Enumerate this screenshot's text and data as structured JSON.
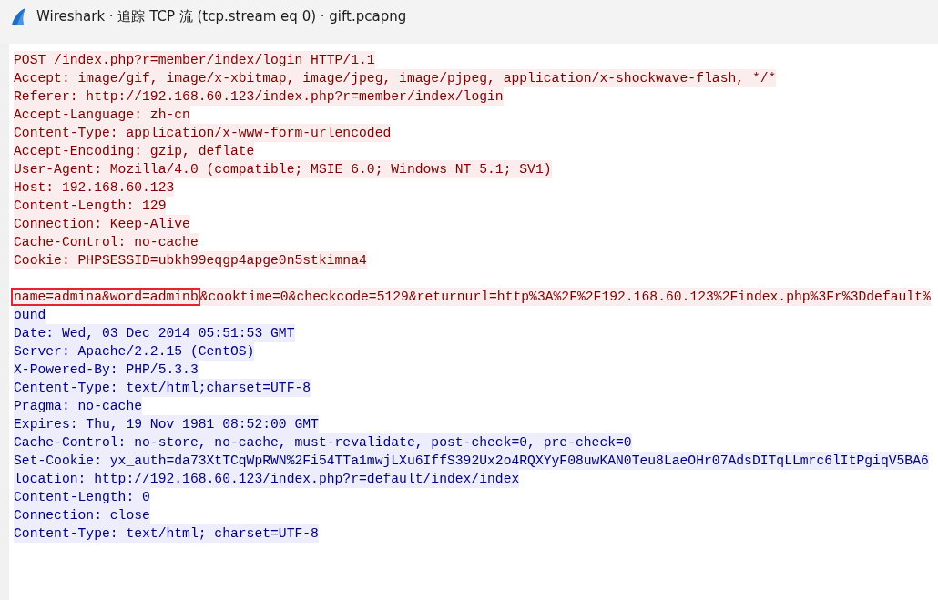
{
  "window": {
    "title": "Wireshark · 追踪 TCP 流 (tcp.stream eq 0) · gift.pcapng"
  },
  "lines": [
    {
      "kind": "client",
      "segments": [
        {
          "text": "POST /index.php?r=member/index/login HTTP/1.1",
          "boxed": false
        }
      ]
    },
    {
      "kind": "client",
      "segments": [
        {
          "text": "Accept: image/gif, image/x-xbitmap, image/jpeg, image/pjpeg, application/x-shockwave-flash, */*",
          "boxed": false
        }
      ]
    },
    {
      "kind": "client",
      "segments": [
        {
          "text": "Referer: http://192.168.60.123/index.php?r=member/index/login",
          "boxed": false
        }
      ]
    },
    {
      "kind": "client",
      "segments": [
        {
          "text": "Accept-Language: zh-cn",
          "boxed": false
        }
      ]
    },
    {
      "kind": "client",
      "segments": [
        {
          "text": "Content-Type: application/x-www-form-urlencoded",
          "boxed": false
        }
      ]
    },
    {
      "kind": "client",
      "segments": [
        {
          "text": "Accept-Encoding: gzip, deflate",
          "boxed": false
        }
      ]
    },
    {
      "kind": "client",
      "segments": [
        {
          "text": "User-Agent: Mozilla/4.0 (compatible; MSIE 6.0; Windows NT 5.1; SV1)",
          "boxed": false
        }
      ]
    },
    {
      "kind": "client",
      "segments": [
        {
          "text": "Host: 192.168.60.123",
          "boxed": false
        }
      ]
    },
    {
      "kind": "client",
      "segments": [
        {
          "text": "Content-Length: 129",
          "boxed": false
        }
      ]
    },
    {
      "kind": "client",
      "segments": [
        {
          "text": "Connection: Keep-Alive",
          "boxed": false
        }
      ]
    },
    {
      "kind": "client",
      "segments": [
        {
          "text": "Cache-Control: no-cache",
          "boxed": false
        }
      ]
    },
    {
      "kind": "client",
      "segments": [
        {
          "text": "Cookie: PHPSESSID=ubkh99eqgp4apge0n5stkimna4",
          "boxed": false
        }
      ]
    },
    {
      "kind": "blank"
    },
    {
      "kind": "client",
      "segments": [
        {
          "text": "name=admina&word=adminb",
          "boxed": true
        },
        {
          "text": "&cooktime=0&checkcode=5129&returnurl=http%3A%2F%2F192.168.60.123%2Findex.php%3Fr%3Ddefault%",
          "boxed": false
        }
      ]
    },
    {
      "kind": "server",
      "segments": [
        {
          "text": "ound",
          "boxed": false
        }
      ]
    },
    {
      "kind": "server",
      "segments": [
        {
          "text": "Date: Wed, 03 Dec 2014 05:51:53 GMT",
          "boxed": false
        }
      ]
    },
    {
      "kind": "server",
      "segments": [
        {
          "text": "Server: Apache/2.2.15 (CentOS)",
          "boxed": false
        }
      ]
    },
    {
      "kind": "server",
      "segments": [
        {
          "text": "X-Powered-By: PHP/5.3.3",
          "boxed": false
        }
      ]
    },
    {
      "kind": "server",
      "segments": [
        {
          "text": "Centent-Type: text/html;charset=UTF-8",
          "boxed": false
        }
      ]
    },
    {
      "kind": "server",
      "segments": [
        {
          "text": "Pragma: no-cache",
          "boxed": false
        }
      ]
    },
    {
      "kind": "server",
      "segments": [
        {
          "text": "Expires: Thu, 19 Nov 1981 08:52:00 GMT",
          "boxed": false
        }
      ]
    },
    {
      "kind": "server",
      "segments": [
        {
          "text": "Cache-Control: no-store, no-cache, must-revalidate, post-check=0, pre-check=0",
          "boxed": false
        }
      ]
    },
    {
      "kind": "server",
      "segments": [
        {
          "text": "Set-Cookie: yx_auth=da73XtTCqWpRWN%2Fi54TTa1mwjLXu6IffS392Ux2o4RQXYyF08uwKAN0Teu8LaeOHr07AdsDITqLLmrc6lItPgiqV5BA6",
          "boxed": false
        }
      ]
    },
    {
      "kind": "server",
      "segments": [
        {
          "text": "location: http://192.168.60.123/index.php?r=default/index/index",
          "boxed": false
        }
      ]
    },
    {
      "kind": "server",
      "segments": [
        {
          "text": "Content-Length: 0",
          "boxed": false
        }
      ]
    },
    {
      "kind": "server",
      "segments": [
        {
          "text": "Connection: close",
          "boxed": false
        }
      ]
    },
    {
      "kind": "server",
      "segments": [
        {
          "text": "Content-Type: text/html; charset=UTF-8",
          "boxed": false
        }
      ]
    }
  ]
}
